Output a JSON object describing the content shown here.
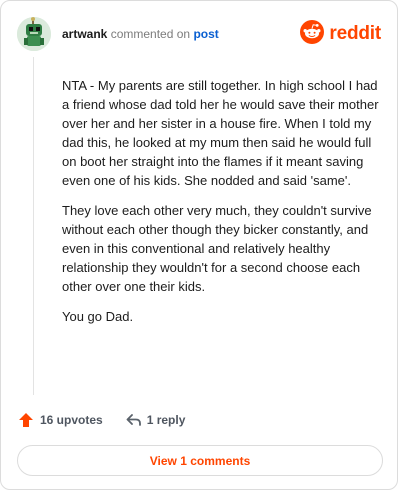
{
  "comment": {
    "username": "artwank",
    "action_text": "commented on",
    "post_link": "post",
    "paragraphs": [
      "NTA - My parents are still together. In high school I had a friend whose dad told her he would save their mother over her and her sister in a house fire. When I told my dad this, he looked at my mum then said he would full on boot her straight into the flames if it meant saving even one of his kids. She nodded and said 'same'.",
      "They love each other very much, they couldn't survive without each other though they bicker constantly, and even in this conventional and relatively healthy relationship they wouldn't for a second choose each other over one their kids.",
      "You go Dad."
    ]
  },
  "brand": {
    "name": "reddit",
    "accent_color": "#ff4500"
  },
  "actions": {
    "upvotes_label": "16 upvotes",
    "replies_label": "1 reply",
    "view_comments_label": "View 1 comments"
  },
  "icons": {
    "avatar": "avatar-icon",
    "logo": "reddit-logo-icon",
    "upvote": "upvote-arrow-icon",
    "reply": "reply-arrow-icon"
  }
}
